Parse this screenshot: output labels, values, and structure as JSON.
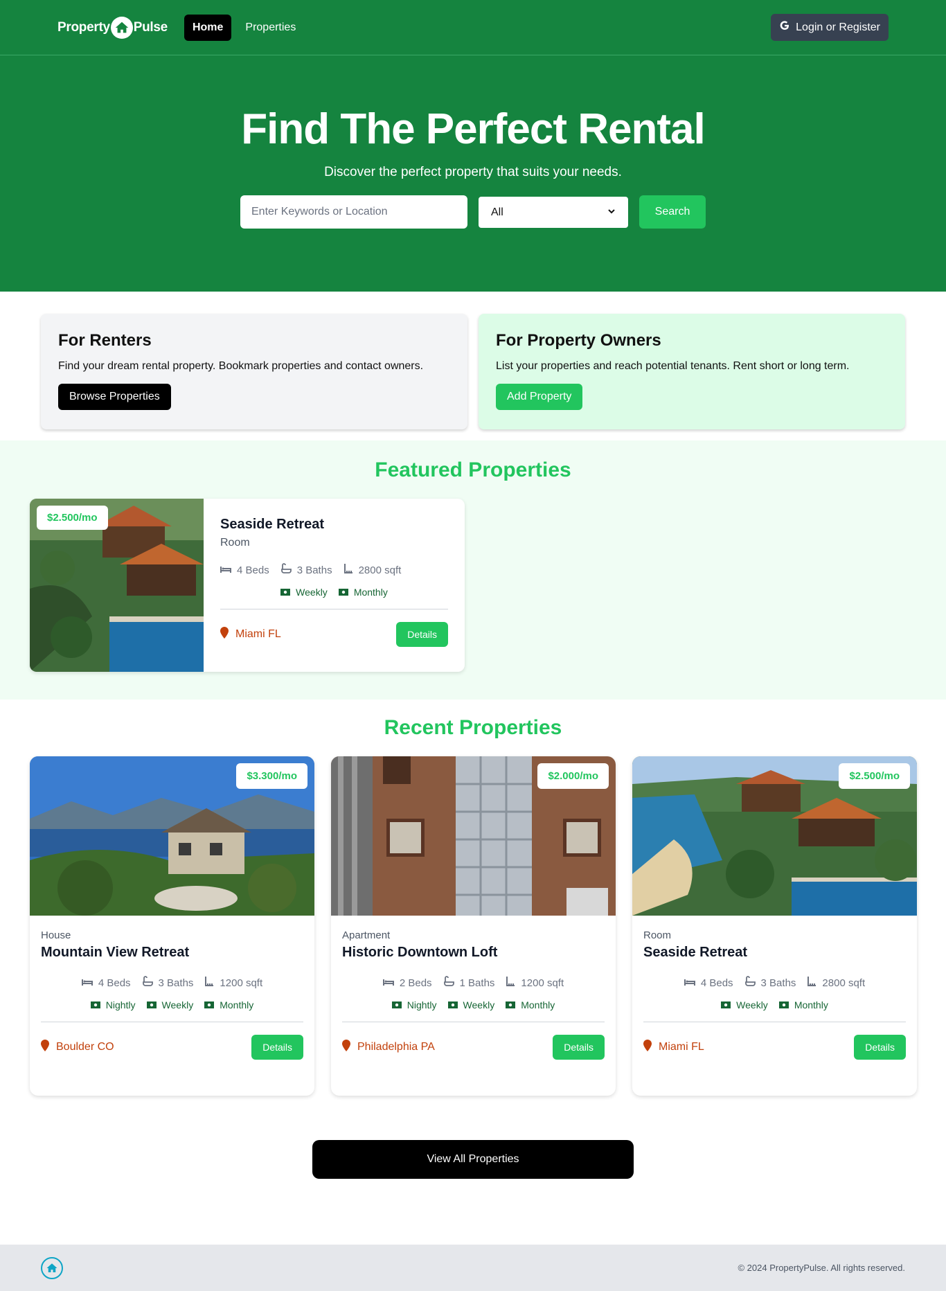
{
  "nav": {
    "logo_left": "Property",
    "logo_right": "Pulse",
    "links": [
      {
        "label": "Home",
        "active": true
      },
      {
        "label": "Properties",
        "active": false
      }
    ],
    "login_label": "Login or Register"
  },
  "hero": {
    "title": "Find The Perfect Rental",
    "subtitle": "Discover the perfect property that suits your needs.",
    "search": {
      "placeholder": "Enter Keywords or Location",
      "type_selected": "All",
      "button_label": "Search"
    }
  },
  "info_boxes": {
    "renters": {
      "title": "For Renters",
      "text": "Find your dream rental property. Bookmark properties and contact owners.",
      "button": "Browse Properties"
    },
    "owners": {
      "title": "For Property Owners",
      "text": "List your properties and reach potential tenants. Rent short or long term.",
      "button": "Add Property"
    }
  },
  "featured": {
    "title": "Featured Properties",
    "items": [
      {
        "price": "$2.500/mo",
        "name": "Seaside Retreat",
        "type": "Room",
        "beds": "4 Beds",
        "baths": "3 Baths",
        "sqft": "2800 sqft",
        "rates": [
          "Weekly",
          "Monthly"
        ],
        "location": "Miami FL",
        "details": "Details"
      }
    ]
  },
  "recent": {
    "title": "Recent Properties",
    "items": [
      {
        "price": "$3.300/mo",
        "type": "House",
        "name": "Mountain View Retreat",
        "beds": "4 Beds",
        "baths": "3 Baths",
        "sqft": "1200 sqft",
        "rates": [
          "Nightly",
          "Weekly",
          "Monthly"
        ],
        "location": "Boulder CO",
        "details": "Details"
      },
      {
        "price": "$2.000/mo",
        "type": "Apartment",
        "name": "Historic Downtown Loft",
        "beds": "2 Beds",
        "baths": "1 Baths",
        "sqft": "1200 sqft",
        "rates": [
          "Nightly",
          "Weekly",
          "Monthly"
        ],
        "location": "Philadelphia PA",
        "details": "Details"
      },
      {
        "price": "$2.500/mo",
        "type": "Room",
        "name": "Seaside Retreat",
        "beds": "4 Beds",
        "baths": "3 Baths",
        "sqft": "2800 sqft",
        "rates": [
          "Weekly",
          "Monthly"
        ],
        "location": "Miami FL",
        "details": "Details"
      }
    ],
    "view_all": "View All Properties"
  },
  "footer": {
    "copyright": "© 2024 PropertyPulse. All rights reserved."
  },
  "colors": {
    "brand_green": "#15843f",
    "accent_green": "#22c55e",
    "location_orange": "#c2410c"
  },
  "icons": [
    "house-logo-icon",
    "google-icon",
    "bed-icon",
    "bath-icon",
    "ruler-icon",
    "money-icon",
    "map-pin-icon"
  ]
}
